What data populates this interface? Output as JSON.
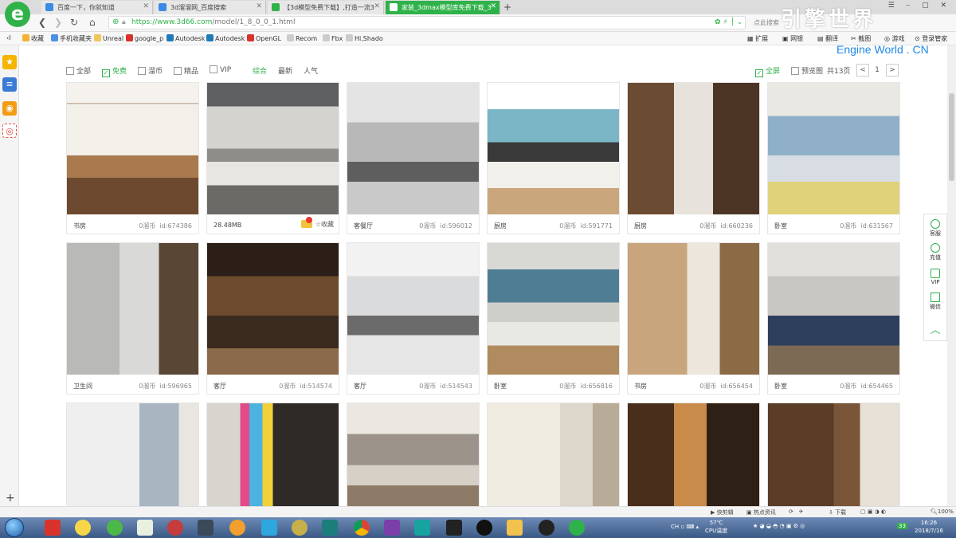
{
  "browser": {
    "tabs": [
      {
        "title": "百度一下，你就知道",
        "icon_color": "#3b8ae6"
      },
      {
        "title": "3d溜溜网_百度搜索",
        "icon_color": "#3b8ae6"
      },
      {
        "title": "【3d模型免费下载】,打造一流3",
        "icon_color": "#2fb24a"
      },
      {
        "title": "家装_3dmax模型库免费下载_3",
        "icon_color": "#ffffff"
      }
    ],
    "url_prefix": "https://",
    "url_host": "www.3d66.com",
    "url_path": "/model/1_8_0_0_1.html",
    "search_hint": "点此搜索",
    "bookmarks": [
      "收藏",
      "手机收藏夹",
      "Unreal",
      "google_p",
      "Autodesk",
      "Autodesk",
      "OpenGL",
      "Recom",
      "Fbx",
      "Hi,Shado"
    ],
    "toolbar_right": [
      "扩展",
      "网银",
      "翻译",
      "截图",
      "游戏",
      "登录管家"
    ]
  },
  "watermark": {
    "title": "引擎世界",
    "subtitle": "Engine World . CN"
  },
  "filters": {
    "checkboxes": [
      {
        "label": "全部",
        "checked": false
      },
      {
        "label": "免费",
        "checked": true
      },
      {
        "label": "溜币",
        "checked": false
      },
      {
        "label": "精品",
        "checked": false
      },
      {
        "label": "VIP",
        "checked": false
      }
    ],
    "sorts": [
      "综合",
      "最新",
      "人气"
    ],
    "fullscreen_label": "全屏",
    "preview_label": "预览图",
    "page_count": "共13页",
    "page_prev": "<",
    "page_current": "1",
    "page_next": ">"
  },
  "cards": [
    {
      "caption": "书房",
      "price": "0溜币",
      "id": "id:674386",
      "scene": "study"
    },
    {
      "caption": "28.48MB",
      "price": "",
      "id": "",
      "scene": "bedroom-gray",
      "hover": true,
      "fav_label": "收藏"
    },
    {
      "caption": "客餐厅",
      "price": "0溜币",
      "id": "id:596012",
      "scene": "living-gray"
    },
    {
      "caption": "厨房",
      "price": "0溜币",
      "id": "id:591771",
      "scene": "kitchen"
    },
    {
      "caption": "厨房",
      "price": "0溜币",
      "id": "id:660236",
      "scene": "kitchen-dark"
    },
    {
      "caption": "卧室",
      "price": "0溜币",
      "id": "id:631567",
      "scene": "bedroom-blue"
    },
    {
      "caption": "卫生间",
      "price": "0溜币",
      "id": "id:596965",
      "scene": "bath"
    },
    {
      "caption": "客厅",
      "price": "0溜币",
      "id": "id:514574",
      "scene": "chinese"
    },
    {
      "caption": "客厅",
      "price": "0溜币",
      "id": "id:514543",
      "scene": "living-white"
    },
    {
      "caption": "卧室",
      "price": "0溜币",
      "id": "id:656816",
      "scene": "bedroom-teal"
    },
    {
      "caption": "书房",
      "price": "0溜币",
      "id": "id:656454",
      "scene": "study-wood"
    },
    {
      "caption": "卧室",
      "price": "0溜币",
      "id": "id:654465",
      "scene": "bedroom-navy"
    },
    {
      "caption": "",
      "price": "",
      "id": "",
      "scene": "room-city"
    },
    {
      "caption": "",
      "price": "",
      "id": "",
      "scene": "bedroom-art"
    },
    {
      "caption": "",
      "price": "",
      "id": "",
      "scene": "bedroom-chand"
    },
    {
      "caption": "",
      "price": "",
      "id": "",
      "scene": "bath-beige"
    },
    {
      "caption": "",
      "price": "",
      "id": "",
      "scene": "library"
    },
    {
      "caption": "",
      "price": "",
      "id": "",
      "scene": "wood-cabinet"
    }
  ],
  "right_panel": [
    "客服",
    "充值",
    "VIP",
    "微信"
  ],
  "statusbar": {
    "left": [
      "快剪辑",
      "热点资讯"
    ],
    "download": "下载",
    "zoom": "100%"
  },
  "taskbar": {
    "temp": "57℃",
    "temp_label": "CPU温度",
    "time": "16:26",
    "date": "2018/7/16",
    "badge": "33"
  },
  "colors": {
    "accent": "#2fb24a",
    "watermark_blue": "#1e88e5"
  }
}
